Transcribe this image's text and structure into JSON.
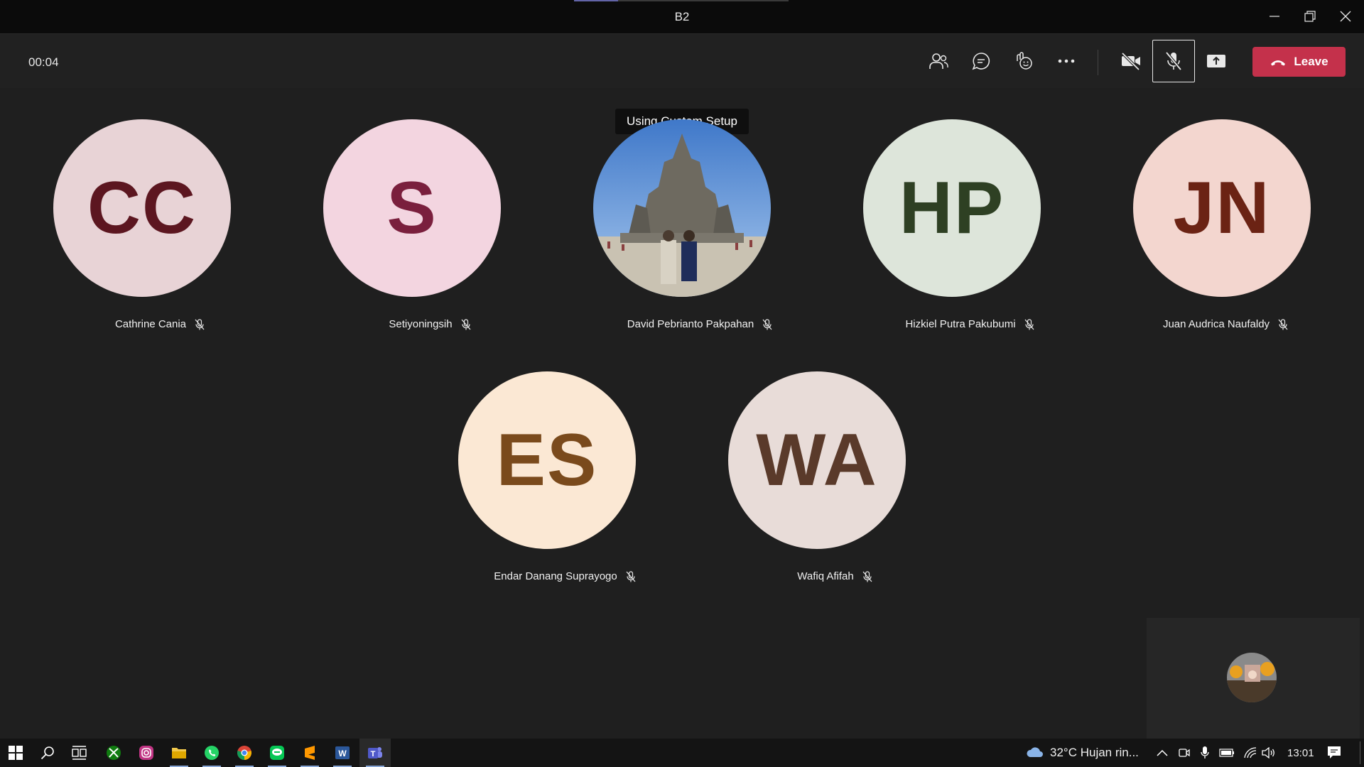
{
  "window": {
    "title": "B2",
    "minimize_icon": "minimize-icon",
    "restore_icon": "restore-icon",
    "close_icon": "close-icon"
  },
  "toolbar": {
    "timer": "00:04",
    "buttons": [
      "participants-icon",
      "chat-icon",
      "reactions-icon",
      "more-options-icon",
      "camera-off-icon",
      "mic-off-icon",
      "share-screen-icon"
    ],
    "leave_label": "Leave",
    "leave_color": "#c4314b"
  },
  "tooltip": "Using Custom Setup",
  "participants": [
    {
      "initials": "CC",
      "name": "Cathrine Cania",
      "bg": "#e8d3d6",
      "fg": "#5c1620",
      "muted": true
    },
    {
      "initials": "S",
      "name": "Setiyoningsih",
      "bg": "#f3d5e0",
      "fg": "#7a1f3d",
      "muted": true
    },
    {
      "initials": "",
      "name": "David Pebrianto Pakpahan",
      "photo": "temple-photo",
      "muted": true
    },
    {
      "initials": "HP",
      "name": "Hizkiel Putra Pakubumi",
      "bg": "#dde5da",
      "fg": "#2e4023",
      "muted": true
    },
    {
      "initials": "JN",
      "name": "Juan Audrica Naufaldy",
      "bg": "#f3d6cf",
      "fg": "#6b2314",
      "muted": true
    },
    {
      "initials": "ES",
      "name": "Endar Danang Suprayogo",
      "bg": "#fbe8d4",
      "fg": "#7a4a1c",
      "muted": true
    },
    {
      "initials": "WA",
      "name": "Wafiq Afifah",
      "bg": "#e8dcd8",
      "fg": "#5a3a2a",
      "muted": true
    }
  ],
  "self_view": {
    "avatar": "self-avatar"
  },
  "taskbar": {
    "apps": [
      "windows-start-icon",
      "search-icon",
      "task-view-icon",
      "xbox-icon",
      "instagram-icon",
      "file-explorer-icon",
      "whatsapp-icon",
      "chrome-icon",
      "line-icon",
      "sublime-text-icon",
      "word-icon",
      "teams-icon"
    ],
    "weather": "32°C  Hujan rin...",
    "clock": "13:01"
  }
}
